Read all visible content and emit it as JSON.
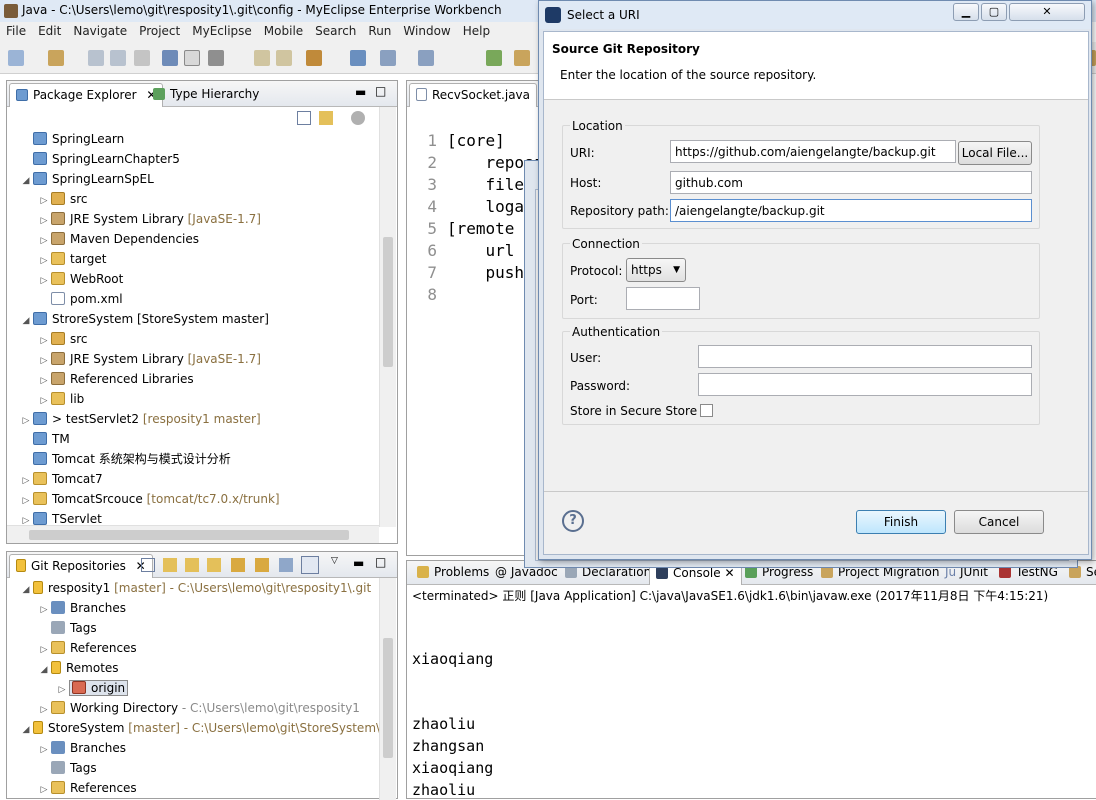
{
  "window": {
    "title": "Java - C:\\Users\\lemo\\git\\resposity1\\.git\\config - MyEclipse Enterprise Workbench"
  },
  "menu": [
    "File",
    "Edit",
    "Navigate",
    "Project",
    "MyEclipse",
    "Mobile",
    "Search",
    "Run",
    "Window",
    "Help"
  ],
  "package_explorer": {
    "tabs": [
      "Package Explorer",
      "Type Hierarchy"
    ],
    "items": [
      {
        "label": "SpringLearn",
        "extra": ""
      },
      {
        "label": "SpringLearnChapter5",
        "extra": ""
      },
      {
        "label": "SpringLearnSpEL",
        "extra": ""
      },
      {
        "label": "src",
        "extra": ""
      },
      {
        "label": "JRE System Library",
        "extra": "[JavaSE-1.7]"
      },
      {
        "label": "Maven Dependencies",
        "extra": ""
      },
      {
        "label": "target",
        "extra": ""
      },
      {
        "label": "WebRoot",
        "extra": ""
      },
      {
        "label": "pom.xml",
        "extra": ""
      },
      {
        "label": "StroreSystem  [StoreSystem master]",
        "extra": ""
      },
      {
        "label": "src",
        "extra": ""
      },
      {
        "label": "JRE System Library",
        "extra": "[JavaSE-1.7]"
      },
      {
        "label": "Referenced Libraries",
        "extra": ""
      },
      {
        "label": "lib",
        "extra": ""
      },
      {
        "label": "> testServlet2",
        "extra": "[resposity1 master]"
      },
      {
        "label": "TM",
        "extra": ""
      },
      {
        "label": "Tomcat 系统架构与模式设计分析",
        "extra": ""
      },
      {
        "label": "Tomcat7",
        "extra": ""
      },
      {
        "label": "TomcatSrcouce",
        "extra": "[tomcat/tc7.0.x/trunk]"
      },
      {
        "label": "TServlet",
        "extra": ""
      }
    ]
  },
  "git_repositories": {
    "tab": "Git Repositories",
    "items": [
      {
        "label": "resposity1",
        "extra": "[master] - C:\\Users\\lemo\\git\\resposity1\\.git"
      },
      {
        "label": "Branches",
        "extra": ""
      },
      {
        "label": "Tags",
        "extra": ""
      },
      {
        "label": "References",
        "extra": ""
      },
      {
        "label": "Remotes",
        "extra": ""
      },
      {
        "label": "origin",
        "extra": ""
      },
      {
        "label": "Working Directory",
        "extra": "- C:\\Users\\lemo\\git\\resposity1"
      },
      {
        "label": "StoreSystem",
        "extra": "[master] - C:\\Users\\lemo\\git\\StoreSystem\\."
      },
      {
        "label": "Branches",
        "extra": ""
      },
      {
        "label": "Tags",
        "extra": ""
      },
      {
        "label": "References",
        "extra": ""
      }
    ]
  },
  "editor": {
    "tab": "RecvSocket.java",
    "line_numbers": [
      "1",
      "2",
      "3",
      "4",
      "5",
      "6",
      "7",
      "8"
    ],
    "lines": [
      "[core]",
      "    reposi",
      "    filem",
      "    loga",
      "[remote",
      "    url",
      "    push",
      ""
    ]
  },
  "console": {
    "tabs": [
      "Problems",
      "Javadoc",
      "Declaration",
      "Console",
      "Progress",
      "Project Migration",
      "JUnit",
      "TestNG",
      "Se"
    ],
    "status": "<terminated> 正则 [Java Application] C:\\java\\JavaSE1.6\\jdk1.6\\bin\\javaw.exe (2017年11月8日 下午4:15:21)",
    "output": [
      "xiaoqiang",
      "zhaoliu",
      "zhangsan",
      "xiaoqiang",
      "zhaoliu"
    ]
  },
  "dialog": {
    "title": "Select a URI",
    "header_title": "Source Git Repository",
    "header_desc": "Enter the location of the source repository.",
    "location": {
      "group": "Location",
      "uri_label": "URI:",
      "uri_value": "https://github.com/aiengelangte/backup.git",
      "local_file_button": "Local File...",
      "host_label": "Host:",
      "host_value": "github.com",
      "repo_path_label": "Repository path:",
      "repo_path_value": "/aiengelangte/backup.git"
    },
    "connection": {
      "group": "Connection",
      "protocol_label": "Protocol:",
      "protocol_value": "https",
      "port_label": "Port:",
      "port_value": ""
    },
    "authentication": {
      "group": "Authentication",
      "user_label": "User:",
      "user_value": "",
      "password_label": "Password:",
      "password_value": "",
      "secure_store_label": "Store in Secure Store"
    },
    "finish_button": "Finish",
    "cancel_button": "Cancel",
    "help_icon": "?"
  }
}
